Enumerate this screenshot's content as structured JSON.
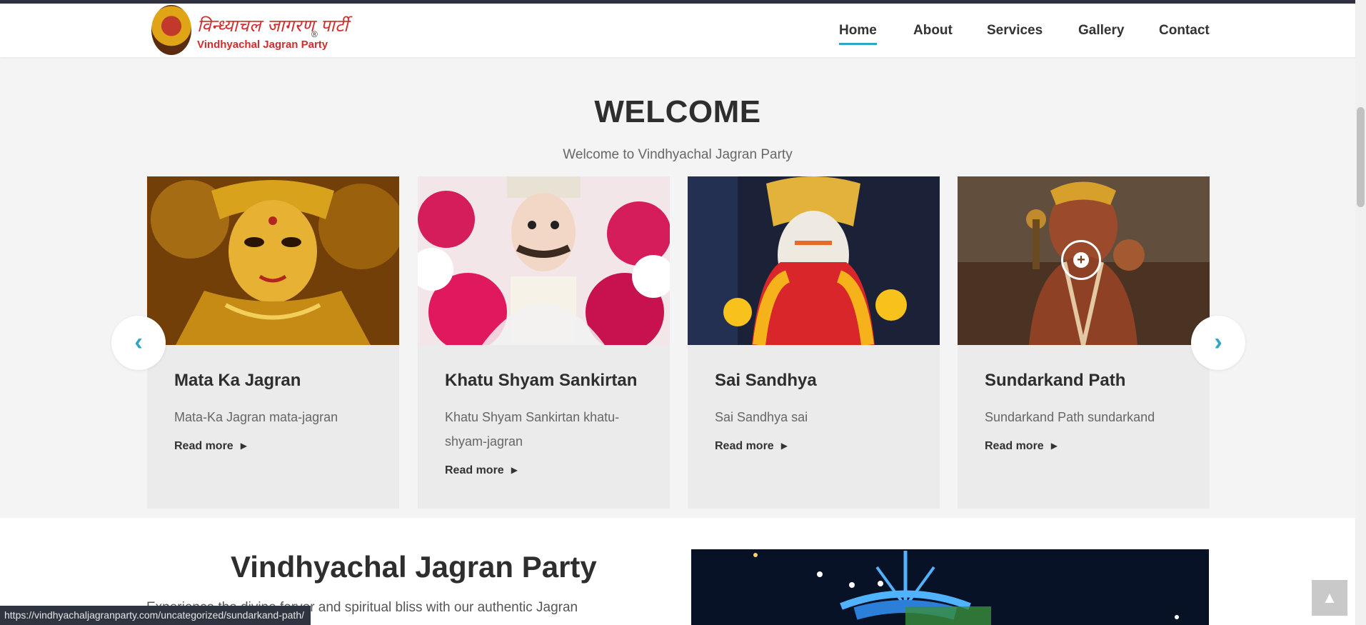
{
  "header": {
    "logo_hindi": "विन्ध्याचल जागरण पार्टी",
    "logo_text": "Vindhyachal Jagran Party",
    "logo_registered": "®",
    "nav": [
      "Home",
      "About",
      "Services",
      "Gallery",
      "Contact"
    ],
    "active_nav": "Home"
  },
  "welcome": {
    "title": "WELCOME",
    "subtitle": "Welcome to Vindhyachal Jagran Party"
  },
  "cards": [
    {
      "title": "Mata Ka Jagran",
      "description": "Mata-Ka Jagran mata-jagran",
      "read_more": "Read more"
    },
    {
      "title": "Khatu Shyam Sankirtan",
      "description": "Khatu Shyam Sankirtan khatu-shyam-jagran",
      "read_more": "Read more"
    },
    {
      "title": "Sai Sandhya",
      "description": "Sai Sandhya sai",
      "read_more": "Read more"
    },
    {
      "title": "Sundarkand Path",
      "description": "Sundarkand Path sundarkand",
      "read_more": "Read more"
    }
  ],
  "carousel": {
    "prev_icon": "chevron-left-icon",
    "next_icon": "chevron-right-icon"
  },
  "about": {
    "title": "Vindhyachal Jagran Party",
    "text_visible": "Experience the divine fervor and spiritual bliss with our authentic Jagran"
  },
  "status_bar": {
    "url": "https://vindhyachaljagranparty.com/uncategorized/sundarkand-path/"
  },
  "colors": {
    "accent": "#2fa6c5",
    "logo_red": "#d12d2d",
    "topbar": "#2f3140"
  }
}
